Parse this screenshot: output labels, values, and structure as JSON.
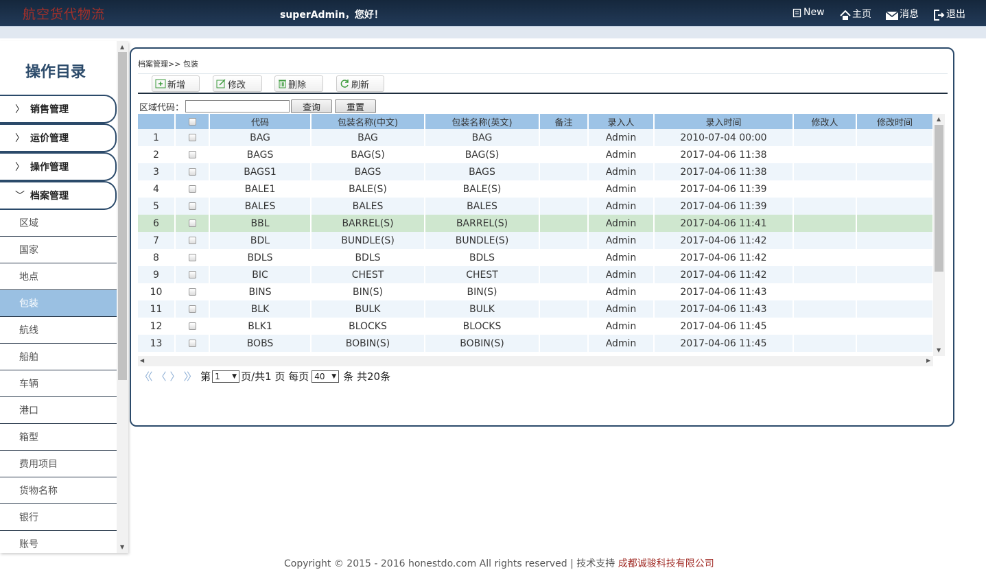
{
  "header": {
    "brand": "航空货代物流",
    "greeting": "superAdmin，您好！",
    "nav": [
      {
        "label": "New",
        "icon": "new-icon"
      },
      {
        "label": "主页",
        "icon": "home-icon"
      },
      {
        "label": "消息",
        "icon": "mail-icon"
      },
      {
        "label": "退出",
        "icon": "logout-icon"
      }
    ]
  },
  "sidebar": {
    "title": "操作目录",
    "groups": [
      {
        "label": "销售管理",
        "expanded": false
      },
      {
        "label": "运价管理",
        "expanded": false
      },
      {
        "label": "操作管理",
        "expanded": false
      },
      {
        "label": "档案管理",
        "expanded": true
      }
    ],
    "items": [
      "区域",
      "国家",
      "地点",
      "包装",
      "航线",
      "船舶",
      "车辆",
      "港口",
      "箱型",
      "费用项目",
      "货物名称",
      "银行",
      "账号"
    ],
    "active_item": "包装"
  },
  "breadcrumb": "档案管理>> 包装",
  "toolbar": {
    "add": "新增",
    "edit": "修改",
    "delete": "删除",
    "refresh": "刷新"
  },
  "filter": {
    "label": "区域代码：",
    "value": "",
    "query": "查询",
    "reset": "重置"
  },
  "grid": {
    "columns": [
      "",
      "",
      "代码",
      "包装名称(中文)",
      "包装名称(英文)",
      "备注",
      "录入人",
      "录入时间",
      "修改人",
      "修改时间"
    ],
    "rows": [
      [
        "1",
        "BAG",
        "BAG",
        "BAG",
        "",
        "Admin",
        "2010-07-04 00:00",
        "",
        ""
      ],
      [
        "2",
        "BAGS",
        "BAG(S)",
        "BAG(S)",
        "",
        "Admin",
        "2017-04-06 11:38",
        "",
        ""
      ],
      [
        "3",
        "BAGS1",
        "BAGS",
        "BAGS",
        "",
        "Admin",
        "2017-04-06 11:38",
        "",
        ""
      ],
      [
        "4",
        "BALE1",
        "BALE(S)",
        "BALE(S)",
        "",
        "Admin",
        "2017-04-06 11:39",
        "",
        ""
      ],
      [
        "5",
        "BALES",
        "BALES",
        "BALES",
        "",
        "Admin",
        "2017-04-06 11:39",
        "",
        ""
      ],
      [
        "6",
        "BBL",
        "BARREL(S)",
        "BARREL(S)",
        "",
        "Admin",
        "2017-04-06 11:41",
        "",
        ""
      ],
      [
        "7",
        "BDL",
        "BUNDLE(S)",
        "BUNDLE(S)",
        "",
        "Admin",
        "2017-04-06 11:42",
        "",
        ""
      ],
      [
        "8",
        "BDLS",
        "BDLS",
        "BDLS",
        "",
        "Admin",
        "2017-04-06 11:42",
        "",
        ""
      ],
      [
        "9",
        "BIC",
        "CHEST",
        "CHEST",
        "",
        "Admin",
        "2017-04-06 11:42",
        "",
        ""
      ],
      [
        "10",
        "BINS",
        "BIN(S)",
        "BIN(S)",
        "",
        "Admin",
        "2017-04-06 11:43",
        "",
        ""
      ],
      [
        "11",
        "BLK",
        "BULK",
        "BULK",
        "",
        "Admin",
        "2017-04-06 11:43",
        "",
        ""
      ],
      [
        "12",
        "BLK1",
        "BLOCKS",
        "BLOCKS",
        "",
        "Admin",
        "2017-04-06 11:45",
        "",
        ""
      ],
      [
        "13",
        "BOBS",
        "BOBIN(S)",
        "BOBIN(S)",
        "",
        "Admin",
        "2017-04-06 11:45",
        "",
        ""
      ]
    ],
    "selected_row": 6
  },
  "pager": {
    "page_prefix": "第",
    "page": "1",
    "page_suffix": "页/共1 页 每页",
    "page_size": "40",
    "count_text": "条 共20条"
  },
  "footer": {
    "text": "Copyright © 2015 - 2016 honestdo.com All rights reserved | 技术支持",
    "company": "成都诚骏科技有限公司"
  },
  "colors": {
    "header_bg": "#1a2e45",
    "brand": "#a3302a",
    "grid_header": "#9dc3e6",
    "selected_row": "#cfe7cf",
    "active_menu": "#9ac0e2"
  }
}
